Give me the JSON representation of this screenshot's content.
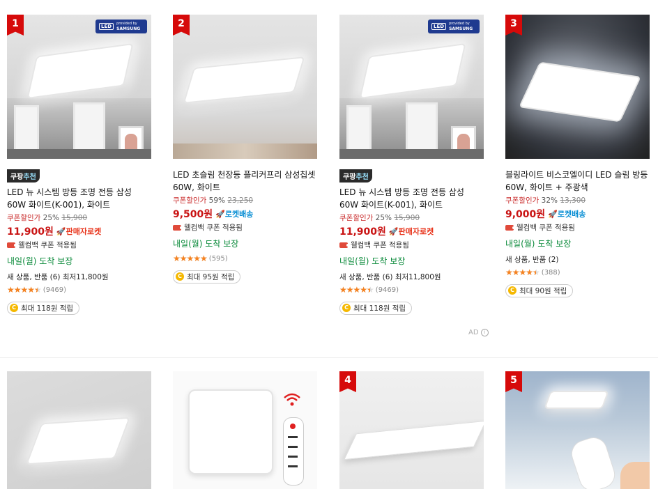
{
  "products": [
    {
      "rank": "1",
      "samsung_badge": true,
      "coupang_pick": {
        "prefix": "쿠팡",
        "highlight": "추천"
      },
      "title": "LED 뉴 시스템 방등 조명 전등 삼성 60W 화이트(K-001), 화이트",
      "discount_label": "쿠폰할인가",
      "discount_rate": "25%",
      "original_price": "15,900",
      "price": "11,900원",
      "shipping": "🚀판매자로켓",
      "shipping_type": "seller",
      "coupon": "웰컴백 쿠폰 적용됨",
      "arrival": "내일(월) 도착 보장",
      "extra": "새 상품, 반품 (6) 최저11,800원",
      "rating": 4.5,
      "review_count": "(9469)",
      "points": "최대 118원 적립"
    },
    {
      "rank": "2",
      "samsung_badge": false,
      "coupang_pick": null,
      "title": "LED 초슬림 천장등 플리커프리 삼성칩셋 60W, 화이트",
      "discount_label": "쿠폰할인가",
      "discount_rate": "59%",
      "original_price": "23,250",
      "price": "9,500원",
      "shipping": "🚀로켓배송",
      "shipping_type": "rocket",
      "coupon": "웰컴백 쿠폰 적용됨",
      "arrival": "내일(월) 도착 보장",
      "extra": "",
      "rating": 5,
      "review_count": "(595)",
      "points": "최대 95원 적립"
    },
    {
      "rank": "",
      "samsung_badge": true,
      "coupang_pick": {
        "prefix": "쿠팡",
        "highlight": "추천"
      },
      "title": "LED 뉴 시스템 방등 조명 전등 삼성 60W 화이트(K-001), 화이트",
      "discount_label": "쿠폰할인가",
      "discount_rate": "25%",
      "original_price": "15,900",
      "price": "11,900원",
      "shipping": "🚀판매자로켓",
      "shipping_type": "seller",
      "coupon": "웰컴백 쿠폰 적용됨",
      "arrival": "내일(월) 도착 보장",
      "extra": "새 상품, 반품 (6) 최저11,800원",
      "rating": 4.5,
      "review_count": "(9469)",
      "points": "최대 118원 적립"
    },
    {
      "rank": "3",
      "samsung_badge": false,
      "coupang_pick": null,
      "title": "블링라이트 비스코엘이디 LED 슬림 방등 60W, 화이트 + 주광색",
      "discount_label": "쿠폰할인가",
      "discount_rate": "32%",
      "original_price": "13,300",
      "price": "9,000원",
      "shipping": "🚀로켓배송",
      "shipping_type": "rocket",
      "coupon": "웰컴백 쿠폰 적용됨",
      "arrival": "내일(월) 도착 보장",
      "extra": "새 상품, 반품 (2)",
      "rating": 4.5,
      "review_count": "(388)",
      "points": "최대 90원 적립"
    }
  ],
  "second_row_ranks": [
    "",
    "",
    "4",
    "5"
  ],
  "samsung_badge_text": {
    "led": "LED",
    "provided": "provided by",
    "brand": "SAMSUNG"
  },
  "ad_label": "AD",
  "colors": {
    "price": "#c91313",
    "rank_badge": "#d60a0a",
    "arrival": "#0a8a3a",
    "rocket": "#0a8fd4",
    "seller_rocket": "#e8331a",
    "star": "#f58220"
  }
}
